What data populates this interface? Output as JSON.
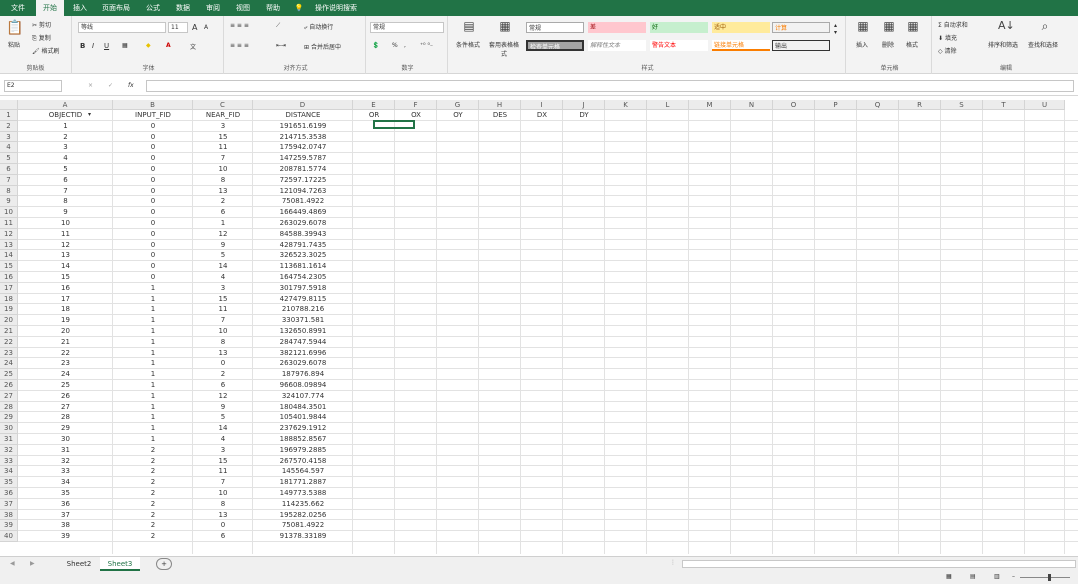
{
  "ribbon_tabs": [
    "文件",
    "开始",
    "插入",
    "页面布局",
    "公式",
    "数据",
    "审阅",
    "视图",
    "帮助",
    "操作说明搜索"
  ],
  "active_tab": "开始",
  "clipboard": {
    "paste": "粘贴",
    "cut": "剪切",
    "copy": "复制",
    "format_painter": "格式刷",
    "label": "剪贴板"
  },
  "font": {
    "name": "等线",
    "size": "11",
    "label": "字体",
    "grow": "A",
    "shrink": "A",
    "bold": "B",
    "italic": "I",
    "underline": "U"
  },
  "alignment": {
    "wrap": "自动换行",
    "merge": "合并后居中",
    "label": "对齐方式"
  },
  "number": {
    "format": "常规",
    "percent": "%",
    "comma": ",",
    "label": "数字"
  },
  "styles": {
    "conditional": "条件格式",
    "table": "套用表格格式",
    "label": "样式",
    "cells": [
      {
        "text": "常规",
        "bg": "#ffffff",
        "color": "#333333"
      },
      {
        "text": "差",
        "bg": "#ffc7ce",
        "color": "#9c0006"
      },
      {
        "text": "好",
        "bg": "#c6efce",
        "color": "#006100"
      },
      {
        "text": "适中",
        "bg": "#ffeb9c",
        "color": "#9c5700"
      },
      {
        "text": "计算",
        "bg": "#f2f2f2",
        "color": "#fa7d00"
      },
      {
        "text": "检查单元格",
        "bg": "#a5a5a5",
        "color": "#ffffff"
      },
      {
        "text": "解释性文本",
        "bg": "#ffffff",
        "color": "#7f7f7f"
      },
      {
        "text": "警告文本",
        "bg": "#ffffff",
        "color": "#ff0000"
      },
      {
        "text": "链接单元格",
        "bg": "#ffffff",
        "color": "#fa7d00"
      },
      {
        "text": "输出",
        "bg": "#f2f2f2",
        "color": "#3f3f3f"
      }
    ]
  },
  "cells_group": {
    "insert": "插入",
    "delete": "删除",
    "format": "格式",
    "label": "单元格"
  },
  "editing": {
    "autosum": "自动求和",
    "fill": "填充",
    "clear": "清除",
    "sort": "排序和筛选",
    "find": "查找和选择",
    "label": "编辑"
  },
  "name_box": "E2",
  "formula_buttons": {
    "cancel": "×",
    "enter": "✓",
    "fx": "fx"
  },
  "columns": [
    "A",
    "B",
    "C",
    "D",
    "E",
    "F",
    "G",
    "H",
    "I",
    "J",
    "K",
    "L",
    "M",
    "N",
    "O",
    "P",
    "Q",
    "R",
    "S",
    "T",
    "U"
  ],
  "headers": [
    "OBJECTID",
    "INPUT_FID",
    "NEAR_FID",
    "DISTANCE",
    "OR",
    "OX",
    "OY",
    "DES",
    "DX",
    "DY"
  ],
  "rows": [
    [
      "1",
      "0",
      "3",
      "191651.6199"
    ],
    [
      "2",
      "0",
      "15",
      "214715.3538"
    ],
    [
      "3",
      "0",
      "11",
      "175942.0747"
    ],
    [
      "4",
      "0",
      "7",
      "147259.5787"
    ],
    [
      "5",
      "0",
      "10",
      "208781.5774"
    ],
    [
      "6",
      "0",
      "8",
      "72597.17225"
    ],
    [
      "7",
      "0",
      "13",
      "121094.7263"
    ],
    [
      "8",
      "0",
      "2",
      "75081.4922"
    ],
    [
      "9",
      "0",
      "6",
      "166449.4869"
    ],
    [
      "10",
      "0",
      "1",
      "263029.6078"
    ],
    [
      "11",
      "0",
      "12",
      "84588.39943"
    ],
    [
      "12",
      "0",
      "9",
      "428791.7435"
    ],
    [
      "13",
      "0",
      "5",
      "326523.3025"
    ],
    [
      "14",
      "0",
      "14",
      "113681.1614"
    ],
    [
      "15",
      "0",
      "4",
      "164754.2305"
    ],
    [
      "16",
      "1",
      "3",
      "301797.5918"
    ],
    [
      "17",
      "1",
      "15",
      "427479.8115"
    ],
    [
      "18",
      "1",
      "11",
      "210788.216"
    ],
    [
      "19",
      "1",
      "7",
      "330371.581"
    ],
    [
      "20",
      "1",
      "10",
      "132650.8991"
    ],
    [
      "21",
      "1",
      "8",
      "284747.5944"
    ],
    [
      "22",
      "1",
      "13",
      "382121.6996"
    ],
    [
      "23",
      "1",
      "0",
      "263029.6078"
    ],
    [
      "24",
      "1",
      "2",
      "187976.894"
    ],
    [
      "25",
      "1",
      "6",
      "96608.09894"
    ],
    [
      "26",
      "1",
      "12",
      "324107.774"
    ],
    [
      "27",
      "1",
      "9",
      "180484.3501"
    ],
    [
      "28",
      "1",
      "5",
      "105401.9844"
    ],
    [
      "29",
      "1",
      "14",
      "237629.1912"
    ],
    [
      "30",
      "1",
      "4",
      "188852.8567"
    ],
    [
      "31",
      "2",
      "3",
      "196979.2885"
    ],
    [
      "32",
      "2",
      "15",
      "267570.4158"
    ],
    [
      "33",
      "2",
      "11",
      "145564.597"
    ],
    [
      "34",
      "2",
      "7",
      "181771.2887"
    ],
    [
      "35",
      "2",
      "10",
      "149773.5388"
    ],
    [
      "36",
      "2",
      "8",
      "114235.662"
    ],
    [
      "37",
      "2",
      "13",
      "195282.0256"
    ],
    [
      "38",
      "2",
      "0",
      "75081.4922"
    ],
    [
      "39",
      "2",
      "6",
      "91378.33189"
    ]
  ],
  "sheets": [
    "Sheet2",
    "Sheet3"
  ],
  "active_sheet": "Sheet3",
  "add_sheet": "+"
}
